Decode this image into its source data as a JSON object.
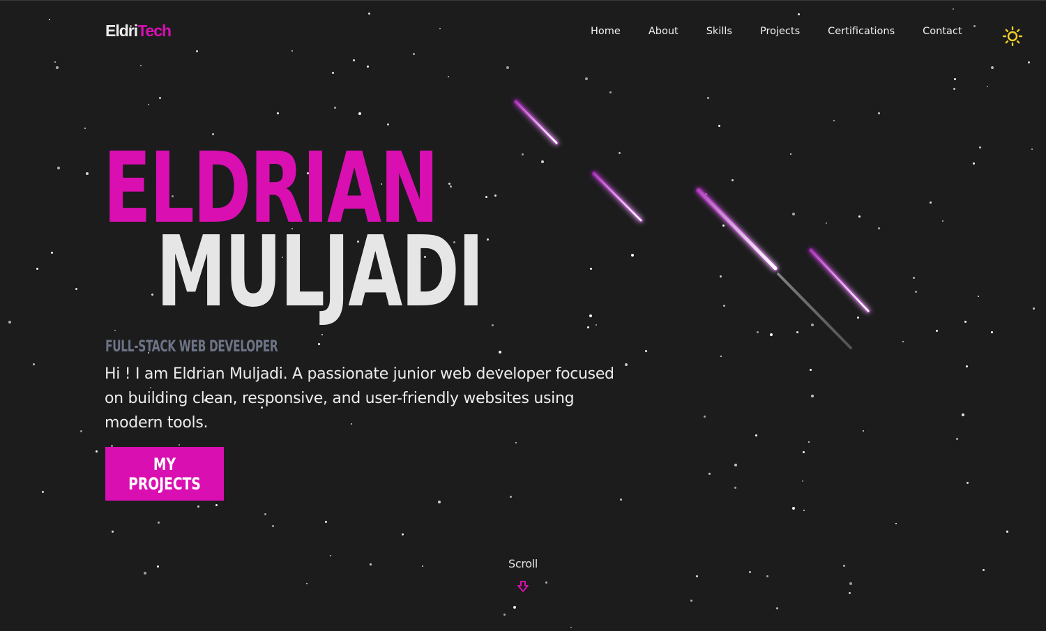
{
  "logo": {
    "part1": "Eldri",
    "part2": "Tech"
  },
  "nav": {
    "items": [
      "Home",
      "About",
      "Skills",
      "Projects",
      "Certifications",
      "Contact"
    ]
  },
  "theme_toggle": {
    "icon": "sun-icon",
    "color": "#f2d024"
  },
  "hero": {
    "first_name": "ELDRIAN",
    "last_name": "MULJADI",
    "role": "FULL-STACK WEB DEVELOPER",
    "description": "Hi ! I am Eldrian Muljadi. A passionate junior web developer focused on building clean, responsive, and user-friendly websites using modern tools.",
    "cta_label": "MY PROJECTS"
  },
  "scroll": {
    "label": "Scroll",
    "icon": "arrow-down-icon"
  },
  "colors": {
    "accent": "#d90fb1",
    "background": "#1c1c1d",
    "text": "#ececec",
    "muted": "#6d7486"
  }
}
